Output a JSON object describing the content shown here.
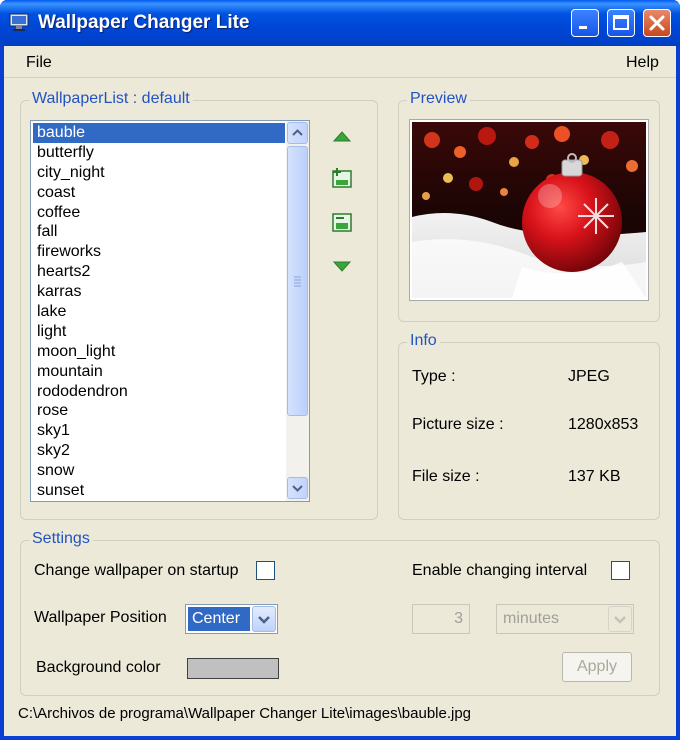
{
  "window": {
    "title": "Wallpaper Changer Lite"
  },
  "menu": {
    "file": "File",
    "help": "Help"
  },
  "wallpaper_list": {
    "group_label": "WallpaperList : default",
    "items": [
      "bauble",
      "butterfly",
      "city_night",
      "coast",
      "coffee",
      "fall",
      "fireworks",
      "hearts2",
      "karras",
      "lake",
      "light",
      "moon_light",
      "mountain",
      "rododendron",
      "rose",
      "sky1",
      "sky2",
      "snow",
      "sunset"
    ],
    "selected": "bauble"
  },
  "preview": {
    "group_label": "Preview"
  },
  "info": {
    "group_label": "Info",
    "type_label": "Type :",
    "type_value": "JPEG",
    "size_label": "Picture size :",
    "size_value": "1280x853",
    "filesize_label": "File size :",
    "filesize_value": "137 KB"
  },
  "settings": {
    "group_label": "Settings",
    "startup_label": "Change wallpaper on startup",
    "startup_checked": false,
    "position_label": "Wallpaper Position",
    "position_value": "Center",
    "bgcolor_label": "Background color",
    "bgcolor": "#c0c0c0",
    "interval_label": "Enable changing interval",
    "interval_checked": false,
    "interval_value": "3",
    "interval_unit": "minutes",
    "apply_label": "Apply"
  },
  "status": {
    "path": "C:\\Archivos de programa\\Wallpaper Changer Lite\\images\\bauble.jpg"
  },
  "colors": {
    "titlebar": "#0046d6",
    "selection": "#316ac5",
    "group_label": "#2253c4",
    "face": "#ece9d8"
  }
}
